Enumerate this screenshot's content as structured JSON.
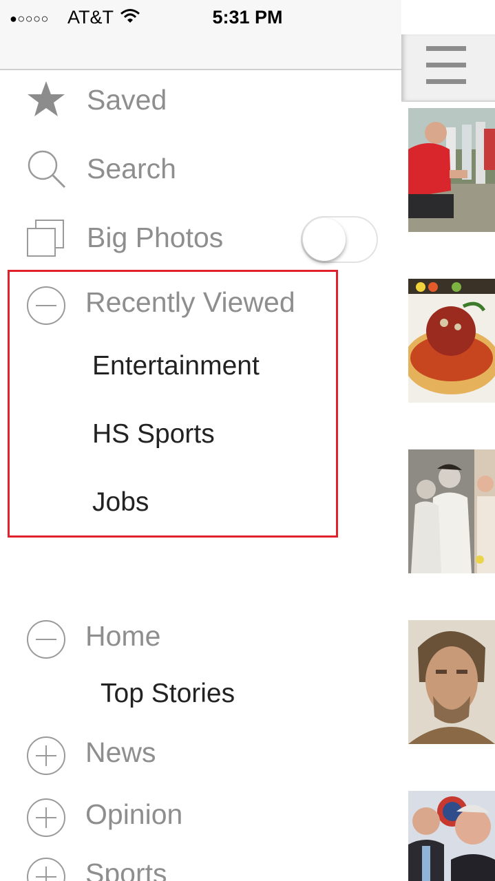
{
  "status_bar": {
    "signal": "●○○○○",
    "carrier": "AT&T",
    "time": "5:31 PM"
  },
  "menu": {
    "saved": "Saved",
    "search": "Search",
    "big_photos": "Big Photos",
    "big_photos_toggle": "off",
    "recently_viewed": {
      "label": "Recently Viewed",
      "items": [
        "Entertainment",
        "HS Sports",
        "Jobs"
      ]
    },
    "home": {
      "label": "Home",
      "items": [
        "Top Stories"
      ]
    },
    "news": "News",
    "opinion": "Opinion",
    "sports": "Sports"
  },
  "colors": {
    "highlight_border": "#e0202a",
    "menu_label": "#8e8e8e",
    "icon_gray": "#9a9a9a"
  },
  "icons": {
    "saved": "star-icon",
    "search": "magnifier-icon",
    "big_photos": "stacked-squares-icon",
    "collapse": "minus-circle-icon",
    "expand": "plus-circle-icon",
    "menu": "hamburger-icon"
  }
}
